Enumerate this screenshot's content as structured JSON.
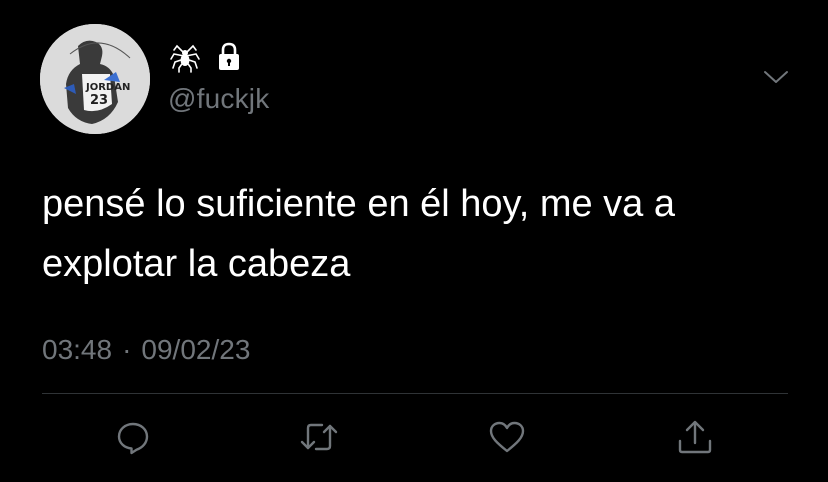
{
  "author": {
    "handle": "@fuckjk",
    "name_icons": [
      "spider-icon",
      "lock-icon"
    ],
    "protected": true
  },
  "tweet": {
    "text": "pensé lo suficiente en él hoy, me va a explotar la cabeza",
    "time": "03:48",
    "separator": "·",
    "date": "09/02/23"
  },
  "actions": [
    {
      "name": "reply",
      "icon": "reply-icon"
    },
    {
      "name": "retweet",
      "icon": "retweet-icon"
    },
    {
      "name": "like",
      "icon": "heart-icon"
    },
    {
      "name": "share",
      "icon": "share-icon"
    }
  ],
  "menu": {
    "icon": "chevron-down-icon"
  },
  "colors": {
    "background": "#000000",
    "text": "#ffffff",
    "secondary": "#71767b",
    "divider": "#2f3336",
    "icon": "#71767b"
  }
}
